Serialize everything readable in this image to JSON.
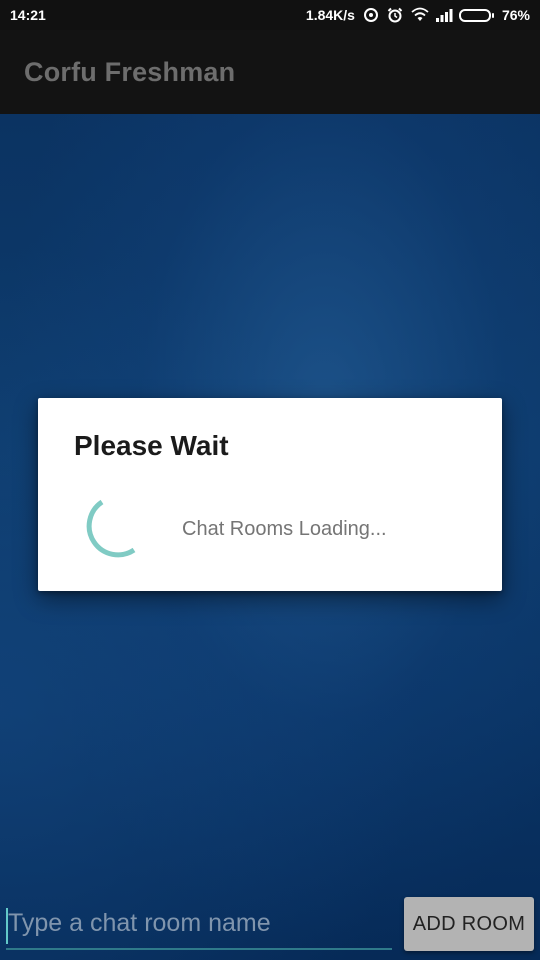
{
  "status_bar": {
    "time": "14:21",
    "network_speed": "1.84K/s",
    "battery_percent": "76%",
    "battery_level": 0.76,
    "icons": [
      "data-saver-icon",
      "alarm-icon",
      "wifi-icon",
      "signal-icon",
      "battery-icon"
    ]
  },
  "app_bar": {
    "title": "Corfu Freshman"
  },
  "dialog": {
    "title": "Please Wait",
    "message": "Chat Rooms Loading...",
    "spinner_color": "#80cbc4"
  },
  "composer": {
    "input_placeholder": "Type a chat room name",
    "input_value": "",
    "add_button_label": "ADD ROOM"
  },
  "colors": {
    "background": "#0a3361",
    "app_bar": "#131313",
    "accent": "#80cbc4"
  }
}
